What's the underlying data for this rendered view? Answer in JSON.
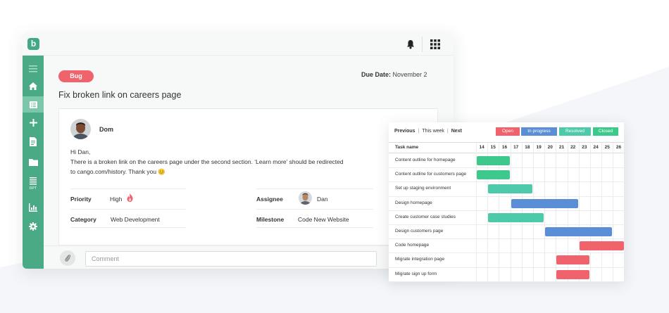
{
  "app": {
    "logo_letter": "b",
    "nav_icons": [
      "menu-icon",
      "home-icon",
      "list-icon",
      "plus-icon",
      "document-icon",
      "folder-icon",
      "report-icon",
      "chart-icon",
      "gear-icon"
    ],
    "topbar_icons": [
      "bell-icon",
      "apps-grid-icon"
    ],
    "accent_color": "#4aaa85"
  },
  "task": {
    "type_badge": "Bug",
    "due_label": "Due Date:",
    "due_value": "November 2",
    "title": "Fix broken link on careers page",
    "author": "Dom",
    "message_lines": [
      "Hi Dan,",
      "There is a broken link on the careers page under the second section. ‘Learn more’ should be redirected",
      "to cango.com/history. Thank you 😊"
    ],
    "priority_label": "Priority",
    "priority_value": "High",
    "assignee_label": "Assignee",
    "assignee_value": "Dan",
    "category_label": "Category",
    "category_value": "Web Development",
    "milestone_label": "Milestone",
    "milestone_value": "Code New Website",
    "comment_placeholder": "Comment"
  },
  "gantt": {
    "nav": {
      "previous": "Previous",
      "this_week": "This week",
      "next": "Next"
    },
    "legend": [
      {
        "label": "Open",
        "color": "#f0636d"
      },
      {
        "label": "In progress",
        "color": "#5a8fd8"
      },
      {
        "label": "Resolved",
        "color": "#4ccaa9"
      },
      {
        "label": "Closed",
        "color": "#3ec98c"
      }
    ],
    "task_header": "Task name",
    "days": [
      "14",
      "15",
      "16",
      "17",
      "18",
      "19",
      "20",
      "21",
      "22",
      "23",
      "24",
      "25",
      "26"
    ],
    "tasks": [
      {
        "name": "Content outline for homepage",
        "start": "14",
        "end": "16",
        "status": "Closed"
      },
      {
        "name": "Content outline for customers page",
        "start": "14",
        "end": "16",
        "status": "Closed"
      },
      {
        "name": "Set up staging environment",
        "start": "15",
        "end": "18",
        "status": "Resolved"
      },
      {
        "name": "Design homepage",
        "start": "17",
        "end": "22",
        "status": "In progress"
      },
      {
        "name": "Create customer case studies",
        "start": "15",
        "end": "19",
        "status": "Resolved"
      },
      {
        "name": "Design customers page",
        "start": "20",
        "end": "25",
        "status": "In progress"
      },
      {
        "name": "Code homepage",
        "start": "23",
        "end": "26",
        "status": "Open"
      },
      {
        "name": "Migrate integration page",
        "start": "21",
        "end": "23",
        "status": "Open"
      },
      {
        "name": "Migrate sign up form",
        "start": "21",
        "end": "23",
        "status": "Open"
      }
    ]
  }
}
